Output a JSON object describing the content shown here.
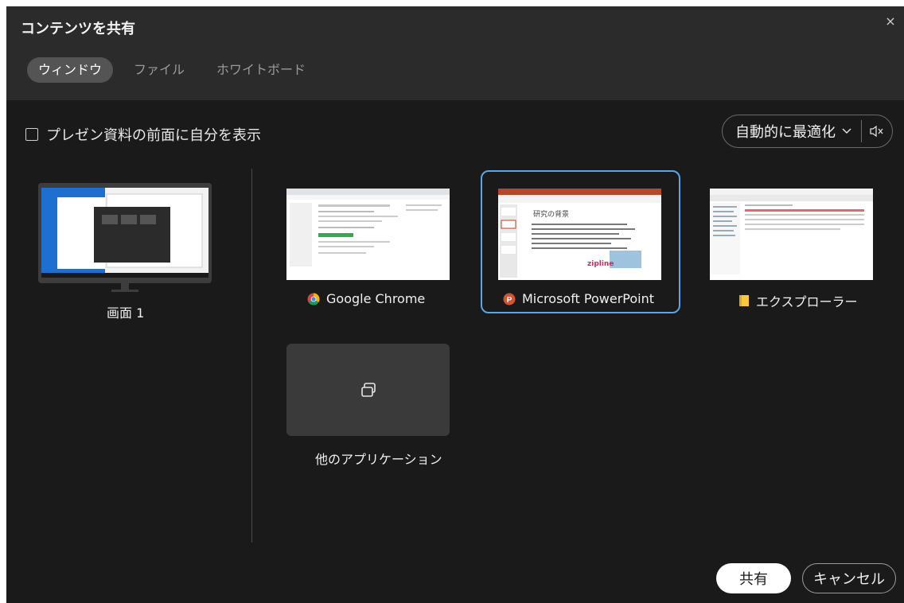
{
  "dialog": {
    "title": "コンテンツを共有",
    "close_label": "×"
  },
  "tabs": [
    {
      "label": "ウィンドウ",
      "active": true
    },
    {
      "label": "ファイル",
      "active": false
    },
    {
      "label": "ホワイトボード",
      "active": false
    }
  ],
  "options": {
    "presenter_label": "プレゼン資料の前面に自分を表示",
    "optimize_label": "自動的に最適化",
    "mute_icon": "speaker-mute-icon"
  },
  "screens": [
    {
      "label": "画面 1"
    }
  ],
  "windows": [
    {
      "label": "Google Chrome",
      "icon": "chrome-icon"
    },
    {
      "label": "Microsoft PowerPoint",
      "icon": "powerpoint-icon",
      "selected": true
    },
    {
      "label": "エクスプローラー",
      "icon": "folder-icon"
    }
  ],
  "other_apps": {
    "label": "他のアプリケーション",
    "icon": "windows-stack-icon"
  },
  "ppt_preview": {
    "heading": "研究の背景",
    "logo_text": "zipline"
  },
  "footer": {
    "share_label": "共有",
    "cancel_label": "キャンセル"
  },
  "colors": {
    "accent": "#5aa6e6",
    "dialog_bg": "#1a1a1a",
    "header_bg": "#2b2b2b",
    "tab_active": "#545454"
  }
}
